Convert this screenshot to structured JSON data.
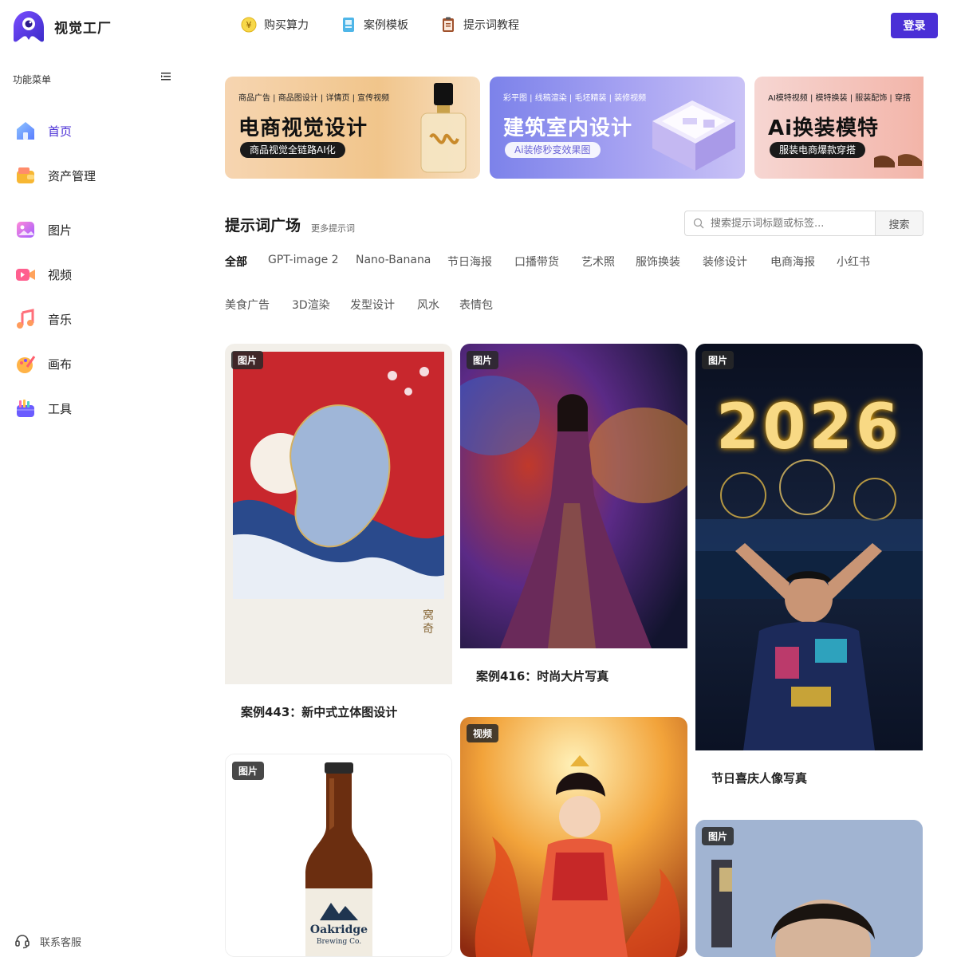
{
  "app": {
    "name": "视觉工厂"
  },
  "topnav": [
    {
      "label": "购买算力",
      "icon": "coin-icon"
    },
    {
      "label": "案例模板",
      "icon": "template-book-icon"
    },
    {
      "label": "提示词教程",
      "icon": "clipboard-icon"
    }
  ],
  "login_label": "登录",
  "sidebar": {
    "menu_title": "功能菜单",
    "items": [
      {
        "label": "首页",
        "icon": "home-icon",
        "active": true
      },
      {
        "label": "资产管理",
        "icon": "wallet-icon"
      },
      {
        "label": "图片",
        "icon": "image-icon"
      },
      {
        "label": "视频",
        "icon": "video-icon"
      },
      {
        "label": "音乐",
        "icon": "music-icon"
      },
      {
        "label": "画布",
        "icon": "canvas-icon"
      },
      {
        "label": "工具",
        "icon": "toolbox-icon"
      }
    ],
    "support_label": "联系客服"
  },
  "banners": [
    {
      "tags": "商品广告 | 商品图设计 | 详情页 | 宣传视频",
      "title": "电商视觉设计",
      "pill": "商品视觉全链路AI化"
    },
    {
      "tags": "彩平图 | 线稿渲染 | 毛坯精装 | 装修视频",
      "title": "建筑室内设计",
      "pill": "Ai装修秒变效果图"
    },
    {
      "tags": "AI模特视频 | 模特换装 | 服装配饰 | 穿搭",
      "title": "Ai换装模特",
      "pill": "服装电商爆款穿搭"
    }
  ],
  "prompt_square": {
    "title": "提示词广场",
    "more": "更多提示词",
    "search_placeholder": "搜索提示词标题或标签...",
    "search_button": "搜索",
    "categories": [
      "全部",
      "GPT-image 2",
      "Nano-Banana",
      "节日海报",
      "口播带货",
      "艺术照",
      "服饰换装",
      "装修设计",
      "电商海报",
      "小红书",
      "美食广告",
      "3D渲染",
      "发型设计",
      "风水",
      "表情包"
    ]
  },
  "cards": [
    {
      "badge": "图片",
      "title": "案例443：新中式立体图设计"
    },
    {
      "badge": "图片",
      "title": "案例416：时尚大片写真"
    },
    {
      "badge": "图片",
      "title": "节日喜庆人像写真",
      "poster_text": "2026"
    },
    {
      "badge": "图片",
      "title": "",
      "label_brand": "Oakridge",
      "label_sub": "Brewing Co."
    },
    {
      "badge": "视频",
      "title": ""
    },
    {
      "badge": "图片",
      "title": ""
    }
  ],
  "colors": {
    "accent": "#4a2fd6"
  }
}
